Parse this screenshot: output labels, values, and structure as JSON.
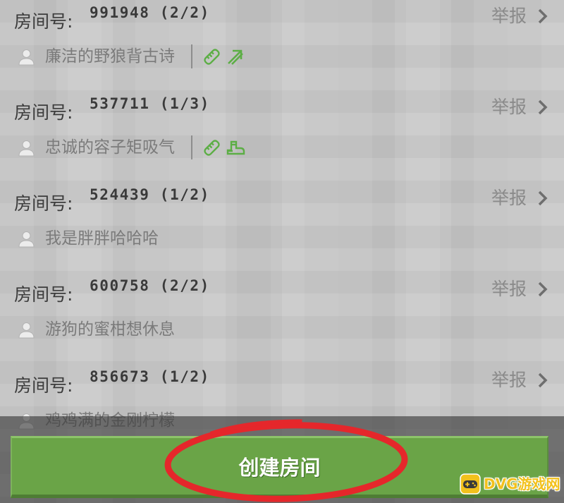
{
  "room_label": "房间号:",
  "report_label": "举报",
  "rooms": [
    {
      "id_text": "991948 (2/2)",
      "owner": "廉洁的野狼背古诗",
      "tag_icons": [
        "ruler-icon",
        "arrow-up-right-icon"
      ]
    },
    {
      "id_text": "537711 (1/3)",
      "owner": "忠诚的容子矩吸气",
      "tag_icons": [
        "ruler-icon",
        "boot-icon"
      ]
    },
    {
      "id_text": "524439 (1/2)",
      "owner": "我是胖胖哈哈哈"
    },
    {
      "id_text": "600758 (2/2)",
      "owner": "游狗的蜜柑想休息"
    },
    {
      "id_text": "856673 (1/2)",
      "owner": "鸡鸡满的金刚柠檬"
    }
  ],
  "icons": {
    "owner": "user-icon",
    "report_arrow": "chevron-right-icon",
    "watermark_logo": "gamepad-icon"
  },
  "create_button_label": "创建房间",
  "watermark": "DVG游戏网",
  "colors": {
    "button_green": "#6aa447",
    "tag_green": "#5cae45",
    "annotation_red": "#e5272b",
    "watermark_yellow": "#f2c11c"
  }
}
